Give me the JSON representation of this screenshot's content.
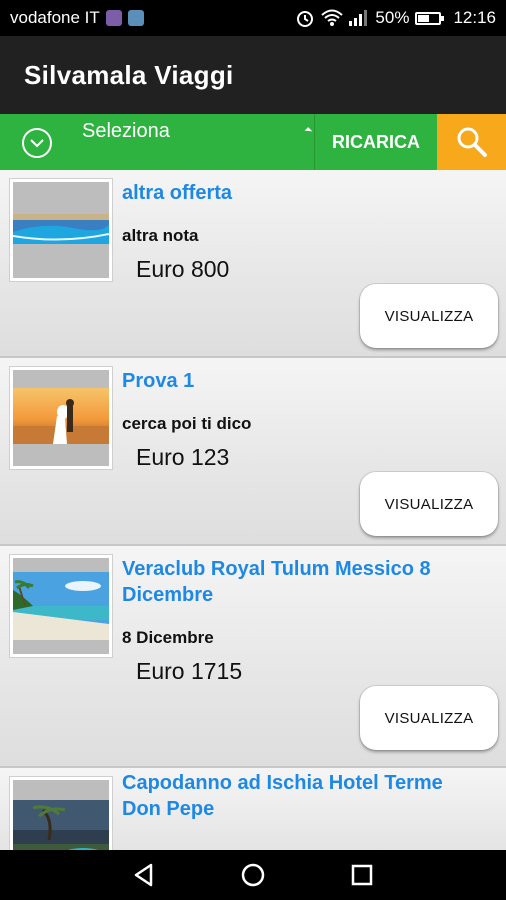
{
  "status": {
    "carrier": "vodafone IT",
    "battery": "50%",
    "time": "12:16"
  },
  "app": {
    "title": "Silvamala Viaggi"
  },
  "toolbar": {
    "select_label": "Seleziona",
    "reload_label": "RICARICA"
  },
  "offers": [
    {
      "title": "altra offerta",
      "note": "altra nota",
      "price": "Euro 800",
      "button": "VISUALIZZA"
    },
    {
      "title": "Prova 1",
      "note": "cerca poi ti dico",
      "price": "Euro 123",
      "button": "VISUALIZZA"
    },
    {
      "title": "Veraclub Royal Tulum Messico 8 Dicembre",
      "note": "8 Dicembre",
      "price": "Euro 1715",
      "button": "VISUALIZZA"
    },
    {
      "title": "Capodanno ad Ischia Hotel Terme Don Pepe",
      "note": "",
      "price": "",
      "button": ""
    }
  ],
  "colors": {
    "accent_green": "#2eb340",
    "search_orange": "#f7a81b",
    "title_blue": "#1e88e5",
    "app_bar": "#212121"
  }
}
